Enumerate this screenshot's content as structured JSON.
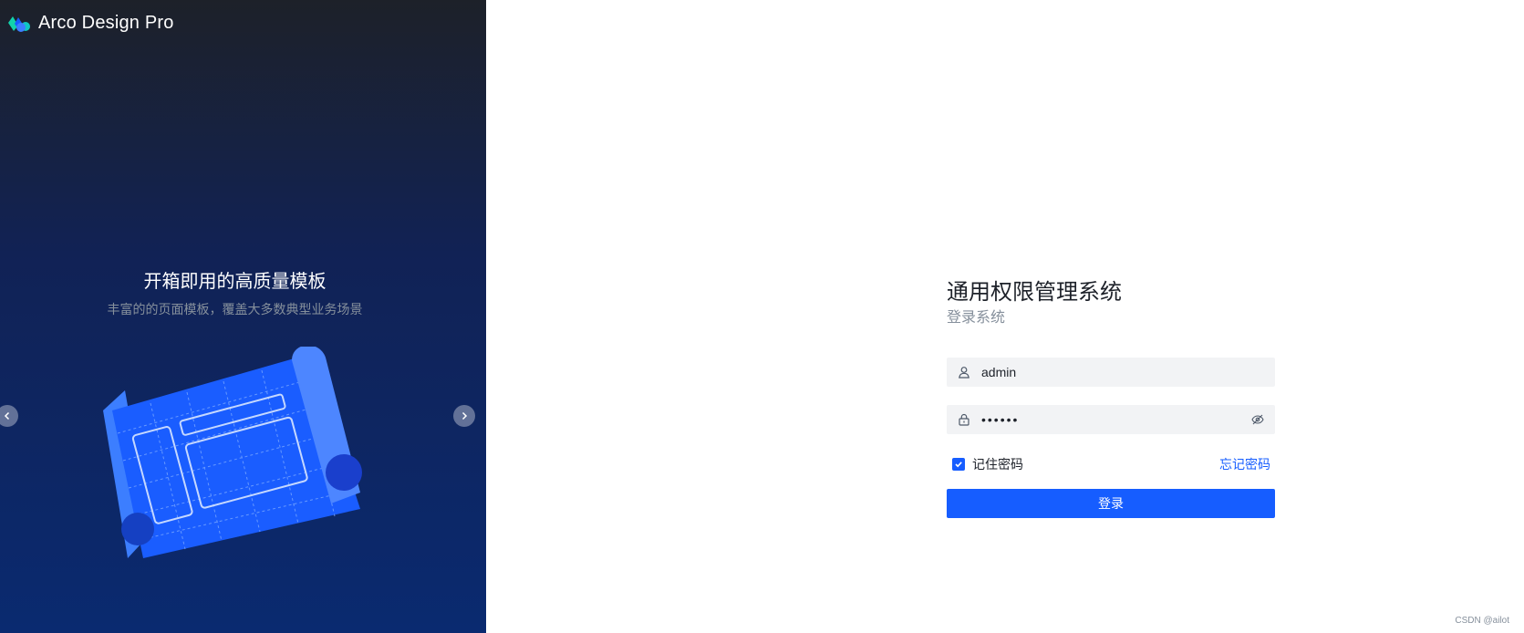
{
  "banner": {
    "logo_text": "Arco Design Pro",
    "slogan_title": "开箱即用的高质量模板",
    "slogan_sub": "丰富的的页面模板，覆盖大多数典型业务场景"
  },
  "login": {
    "title": "通用权限管理系统",
    "subtitle": "登录系统",
    "username_value": "admin",
    "password_value": "••••••",
    "remember_label": "记住密码",
    "remember_checked": true,
    "forgot_label": "忘记密码",
    "submit_label": "登录"
  },
  "footer": {
    "watermark": "CSDN @ailot"
  },
  "colors": {
    "primary": "#165dff",
    "banner_top": "#1d2129",
    "banner_bottom": "#0a2a70"
  },
  "icons": {
    "username": "user-icon",
    "password": "lock-icon",
    "toggle_password": "eye-invisible-icon",
    "prev": "chevron-left-icon",
    "next": "chevron-right-icon"
  }
}
